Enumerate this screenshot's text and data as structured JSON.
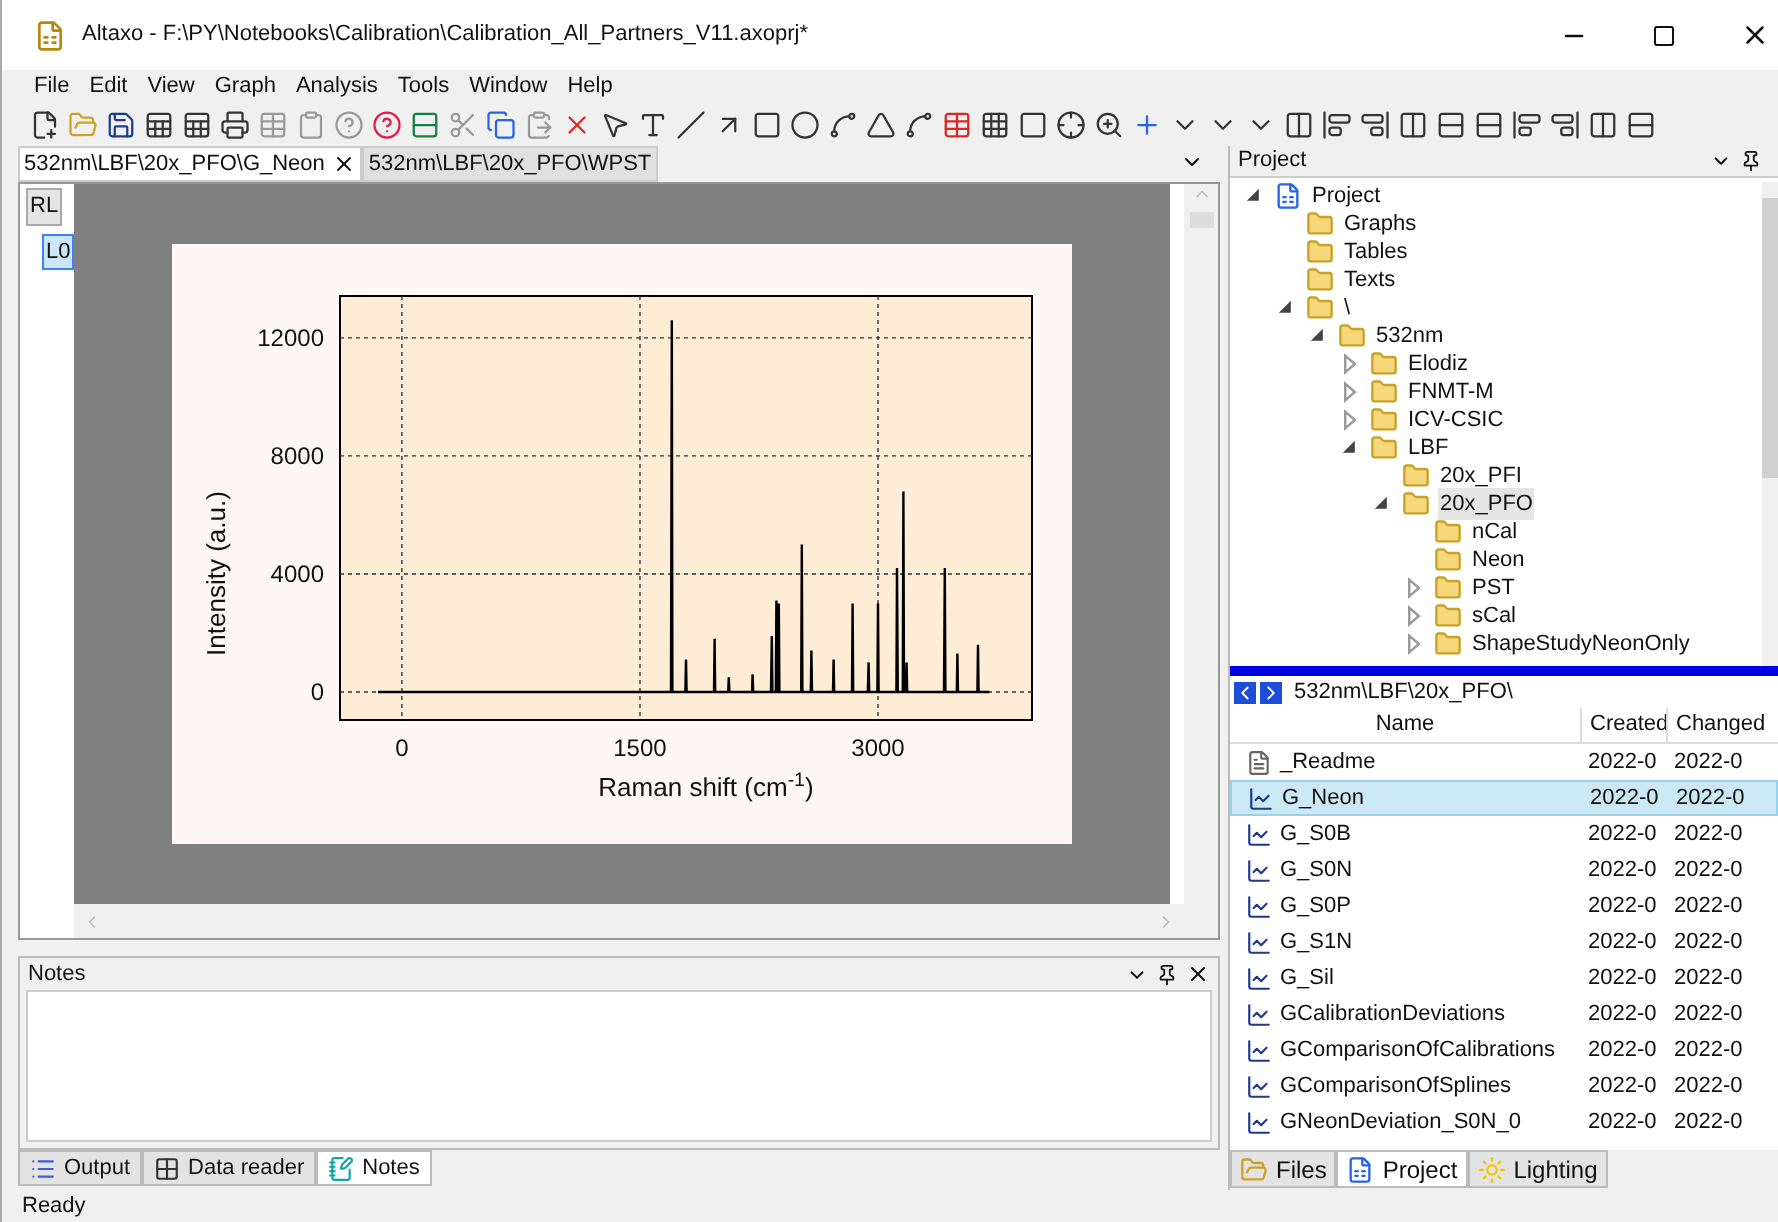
{
  "window": {
    "title": "Altaxo - F:\\PY\\Notebooks\\Calibration\\Calibration_All_Partners_V11.axoprj*"
  },
  "menu": [
    "File",
    "Edit",
    "View",
    "Graph",
    "Analysis",
    "Tools",
    "Window",
    "Help"
  ],
  "document_tabs": [
    {
      "label": "532nm\\LBF\\20x_PFO\\G_Neon",
      "selected": true
    },
    {
      "label": "532nm\\LBF\\20x_PFO\\WPST",
      "selected": false
    }
  ],
  "layers": [
    {
      "label": "RL",
      "selected": false
    },
    {
      "label": "L0",
      "selected": true
    }
  ],
  "graph": {
    "xlabel": "Raman shift (cm$^{-1}$)",
    "ylabel": "Intensity (a.u.)",
    "chart_data": {
      "type": "line",
      "grid": true,
      "xlim": [
        -390,
        3970
      ],
      "ylim": [
        -950,
        13420
      ],
      "xticks": [
        0,
        1500,
        3000
      ],
      "yticks": [
        0,
        4000,
        8000,
        12000
      ],
      "x": [
        -150,
        1696,
        1700,
        1704,
        1786,
        1790,
        1794,
        1966,
        1970,
        1974,
        2056,
        2060,
        2064,
        2206,
        2210,
        2214,
        2326,
        2330,
        2334,
        2356,
        2360,
        2364,
        2371,
        2375,
        2379,
        2516,
        2520,
        2524,
        2576,
        2580,
        2584,
        2716,
        2720,
        2724,
        2836,
        2840,
        2844,
        2936,
        2940,
        2944,
        2996,
        3000,
        3004,
        3116,
        3120,
        3124,
        3156,
        3160,
        3164,
        3176,
        3180,
        3184,
        3416,
        3420,
        3424,
        3496,
        3500,
        3504,
        3626,
        3630,
        3634,
        3700
      ],
      "series": [
        {
          "color": "#000000",
          "values": [
            0,
            0,
            12600,
            0,
            0,
            1100,
            0,
            0,
            1800,
            0,
            0,
            500,
            0,
            0,
            600,
            0,
            0,
            1900,
            0,
            0,
            3100,
            0,
            0,
            3000,
            0,
            0,
            5000,
            0,
            0,
            1400,
            0,
            0,
            1100,
            0,
            0,
            3000,
            0,
            0,
            1000,
            0,
            0,
            3000,
            0,
            0,
            4200,
            0,
            0,
            6800,
            0,
            0,
            1000,
            0,
            0,
            4200,
            0,
            0,
            1300,
            0,
            0,
            1600,
            0,
            0
          ]
        }
      ]
    }
  },
  "notes": {
    "title": "Notes"
  },
  "bottom_tabs": [
    {
      "label": "Output",
      "kind": "output",
      "selected": false
    },
    {
      "label": "Data reader",
      "kind": "reader",
      "selected": false
    },
    {
      "label": "Notes",
      "kind": "notes",
      "selected": true
    }
  ],
  "status_bar": "Ready",
  "project_panel": {
    "title": "Project",
    "tree": [
      {
        "label": "Project",
        "kind": "project",
        "expanded": true,
        "selected": false,
        "children": [
          {
            "label": "Graphs",
            "kind": "folder",
            "selected": false
          },
          {
            "label": "Tables",
            "kind": "folder",
            "selected": false
          },
          {
            "label": "Texts",
            "kind": "folder",
            "selected": false
          },
          {
            "label": "\\",
            "kind": "folder",
            "expanded": true,
            "selected": false,
            "children": [
              {
                "label": "532nm",
                "kind": "folder",
                "expanded": true,
                "selected": false,
                "children": [
                  {
                    "label": "Elodiz",
                    "kind": "folder",
                    "expanded": false,
                    "selected": false
                  },
                  {
                    "label": "FNMT-M",
                    "kind": "folder",
                    "expanded": false,
                    "selected": false
                  },
                  {
                    "label": "ICV-CSIC",
                    "kind": "folder",
                    "expanded": false,
                    "selected": false
                  },
                  {
                    "label": "LBF",
                    "kind": "folder",
                    "expanded": true,
                    "selected": false,
                    "children": [
                      {
                        "label": "20x_PFI",
                        "kind": "folder",
                        "selected": false
                      },
                      {
                        "label": "20x_PFO",
                        "kind": "folder",
                        "expanded": true,
                        "selected": true,
                        "children": [
                          {
                            "label": "nCal",
                            "kind": "folder",
                            "selected": false
                          },
                          {
                            "label": "Neon",
                            "kind": "folder",
                            "selected": false
                          },
                          {
                            "label": "PST",
                            "kind": "folder",
                            "expanded": false,
                            "selected": false
                          },
                          {
                            "label": "sCal",
                            "kind": "folder",
                            "expanded": false,
                            "selected": false
                          },
                          {
                            "label": "ShapeStudyNeonOnly",
                            "kind": "folder",
                            "expanded": false,
                            "selected": false
                          }
                        ]
                      }
                    ]
                  }
                ]
              }
            ]
          }
        ]
      }
    ],
    "path": "532nm\\LBF\\20x_PFO\\",
    "columns": [
      "Name",
      "Created",
      "Changed"
    ],
    "rows": [
      {
        "kind": "text",
        "name": "_Readme",
        "created": "2022-0",
        "changed": "2022-0",
        "selected": false
      },
      {
        "kind": "graph",
        "name": "G_Neon",
        "created": "2022-0",
        "changed": "2022-0",
        "selected": true
      },
      {
        "kind": "graph",
        "name": "G_S0B",
        "created": "2022-0",
        "changed": "2022-0",
        "selected": false
      },
      {
        "kind": "graph",
        "name": "G_S0N",
        "created": "2022-0",
        "changed": "2022-0",
        "selected": false
      },
      {
        "kind": "graph",
        "name": "G_S0P",
        "created": "2022-0",
        "changed": "2022-0",
        "selected": false
      },
      {
        "kind": "graph",
        "name": "G_S1N",
        "created": "2022-0",
        "changed": "2022-0",
        "selected": false
      },
      {
        "kind": "graph",
        "name": "G_Sil",
        "created": "2022-0",
        "changed": "2022-0",
        "selected": false
      },
      {
        "kind": "graph",
        "name": "GCalibrationDeviations",
        "created": "2022-0",
        "changed": "2022-0",
        "selected": false
      },
      {
        "kind": "graph",
        "name": "GComparisonOfCalibrations",
        "created": "2022-0",
        "changed": "2022-0",
        "selected": false
      },
      {
        "kind": "graph",
        "name": "GComparisonOfSplines",
        "created": "2022-0",
        "changed": "2022-0",
        "selected": false
      },
      {
        "kind": "graph",
        "name": "GNeonDeviation_S0N_0",
        "created": "2022-0",
        "changed": "2022-0",
        "selected": false
      }
    ],
    "tabs": [
      {
        "label": "Files",
        "kind": "files",
        "selected": false
      },
      {
        "label": "Project",
        "kind": "project",
        "selected": true
      },
      {
        "label": "Lighting",
        "kind": "lighting",
        "selected": false
      }
    ]
  }
}
